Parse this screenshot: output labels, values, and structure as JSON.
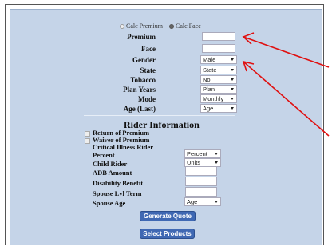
{
  "quote": {
    "mode_options": [
      "Calc Premium",
      "Calc Face"
    ],
    "selected_mode": "Calc Face",
    "fields": {
      "premium_label": "Premium",
      "face_label": "Face",
      "gender_label": "Gender",
      "gender_value": "Male",
      "state_label": "State",
      "state_value": "State",
      "tobacco_label": "Tobacco",
      "tobacco_value": "No",
      "plan_years_label": "Plan Years",
      "plan_years_value": "Plan",
      "mode_label": "Mode",
      "mode_value": "Monthly",
      "age_label": "Age (Last)",
      "age_value": "Age"
    }
  },
  "rider": {
    "title": "Rider Information",
    "return_premium": "Return of Premium",
    "waiver_premium": "Waiver of Premium",
    "critical_illness": "Critical Illness Rider",
    "percent_label": "Percent",
    "percent_value": "Percent",
    "child_label": "Child Rider",
    "child_value": "Units",
    "adb_label": "ADB Amount",
    "disability_label": "Disability Benefit",
    "spouse_term_label": "Spouse Lvl Term",
    "spouse_age_label": "Spouse Age",
    "spouse_age_value": "Age"
  },
  "buttons": {
    "generate": "Generate Quote",
    "select": "Select Products"
  },
  "colors": {
    "panel_bg": "#c5d4e8",
    "button_bg": "#3f68b3",
    "annotation_arrow": "#e01010"
  }
}
